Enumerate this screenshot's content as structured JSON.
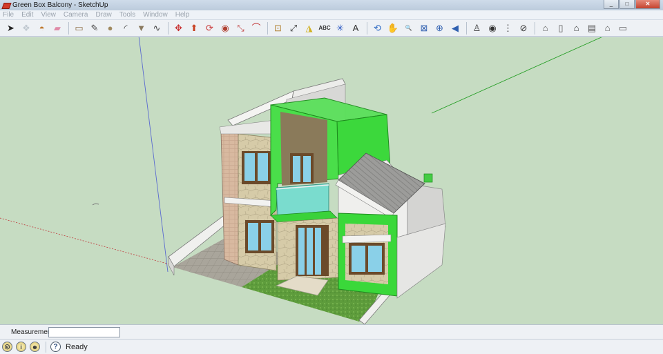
{
  "window": {
    "title": "Green Box Balcony - SketchUp",
    "controls": {
      "minimize": "_",
      "maximize": "□",
      "close": "✕"
    }
  },
  "menu": [
    "File",
    "Edit",
    "View",
    "Camera",
    "Draw",
    "Tools",
    "Window",
    "Help"
  ],
  "toolbar": [
    {
      "name": "select-tool",
      "icon": "arrow-cursor-icon",
      "glyph": "➤",
      "color": "#222222"
    },
    {
      "name": "make-component-tool",
      "icon": "component-icon",
      "glyph": "❖",
      "color": "#c0c8d0"
    },
    {
      "name": "paint-bucket-tool",
      "icon": "paint-bucket-icon",
      "glyph": "◓",
      "color": "#c07a30"
    },
    {
      "name": "eraser-tool",
      "icon": "eraser-icon",
      "glyph": "▰",
      "color": "#e08aa8"
    },
    {
      "sep": true
    },
    {
      "name": "rectangle-tool",
      "icon": "rectangle-icon",
      "glyph": "▭",
      "color": "#8a6a40"
    },
    {
      "name": "line-tool",
      "icon": "pencil-icon",
      "glyph": "✎",
      "color": "#4a4a4a"
    },
    {
      "name": "circle-tool",
      "icon": "circle-icon",
      "glyph": "●",
      "color": "#a08a60"
    },
    {
      "name": "arc-tool",
      "icon": "arc-icon",
      "glyph": "◜",
      "color": "#444444"
    },
    {
      "name": "polygon-tool",
      "icon": "polygon-icon",
      "glyph": "▼",
      "color": "#8a7a60"
    },
    {
      "name": "freehand-tool",
      "icon": "freehand-icon",
      "glyph": "∿",
      "color": "#444444"
    },
    {
      "sep": true
    },
    {
      "name": "move-tool",
      "icon": "move-icon",
      "glyph": "✥",
      "color": "#c83030"
    },
    {
      "name": "push-pull-tool",
      "icon": "push-pull-icon",
      "glyph": "⬆",
      "color": "#c84020"
    },
    {
      "name": "rotate-tool",
      "icon": "rotate-icon",
      "glyph": "⟳",
      "color": "#c83030"
    },
    {
      "name": "follow-me-tool",
      "icon": "follow-me-icon",
      "glyph": "◉",
      "color": "#b04030"
    },
    {
      "name": "scale-tool",
      "icon": "scale-icon",
      "glyph": "⤡",
      "color": "#c04040"
    },
    {
      "name": "offset-tool",
      "icon": "offset-icon",
      "glyph": "⌒",
      "color": "#c03030"
    },
    {
      "sep": true
    },
    {
      "name": "tape-measure-tool",
      "icon": "tape-measure-icon",
      "glyph": "⊡",
      "color": "#b08030"
    },
    {
      "name": "dimension-tool",
      "icon": "dimension-icon",
      "glyph": "⤢",
      "color": "#333333"
    },
    {
      "name": "protractor-tool",
      "icon": "protractor-icon",
      "glyph": "◮",
      "color": "#d0b020"
    },
    {
      "name": "text-tool",
      "icon": "text-icon",
      "glyph": "ABC",
      "color": "#333333"
    },
    {
      "name": "axes-tool",
      "icon": "axes-icon",
      "glyph": "✳",
      "color": "#2050c0"
    },
    {
      "name": "3d-text-tool",
      "icon": "3d-text-icon",
      "glyph": "A",
      "color": "#333333"
    },
    {
      "sep": true
    },
    {
      "name": "orbit-tool",
      "icon": "orbit-icon",
      "glyph": "⟲",
      "color": "#2060c0"
    },
    {
      "name": "pan-tool",
      "icon": "hand-icon",
      "glyph": "✋",
      "color": "#666666"
    },
    {
      "name": "zoom-tool",
      "icon": "magnifier-icon",
      "glyph": "🔍",
      "color": "#3060b0"
    },
    {
      "name": "zoom-window-tool",
      "icon": "zoom-window-icon",
      "glyph": "⊠",
      "color": "#3060b0"
    },
    {
      "name": "zoom-extents-tool",
      "icon": "zoom-extents-icon",
      "glyph": "⊕",
      "color": "#3060b0"
    },
    {
      "name": "previous-view-tool",
      "icon": "previous-view-icon",
      "glyph": "◀",
      "color": "#3060b0"
    },
    {
      "sep": true
    },
    {
      "name": "position-camera-tool",
      "icon": "position-camera-icon",
      "glyph": "♙",
      "color": "#333333"
    },
    {
      "name": "look-around-tool",
      "icon": "eye-icon",
      "glyph": "◉",
      "color": "#333333"
    },
    {
      "name": "walk-tool",
      "icon": "footprints-icon",
      "glyph": "⋮",
      "color": "#222222"
    },
    {
      "name": "section-plane-tool",
      "icon": "section-plane-icon",
      "glyph": "⊘",
      "color": "#333333"
    },
    {
      "sep": true
    },
    {
      "name": "iso-view",
      "icon": "iso-house-icon",
      "glyph": "⌂",
      "color": "#555555"
    },
    {
      "name": "top-view",
      "icon": "top-house-icon",
      "glyph": "▯",
      "color": "#555555"
    },
    {
      "name": "front-view",
      "icon": "front-house-icon",
      "glyph": "⌂",
      "color": "#333333"
    },
    {
      "name": "right-view",
      "icon": "right-house-icon",
      "glyph": "▤",
      "color": "#555555"
    },
    {
      "name": "back-view",
      "icon": "back-house-icon",
      "glyph": "⌂",
      "color": "#555555"
    },
    {
      "name": "left-view",
      "icon": "left-house-icon",
      "glyph": "▭",
      "color": "#555555"
    }
  ],
  "viewport": {
    "background": "#c6dcc2",
    "colors": {
      "balcony_green": "#3cdc3c",
      "wall_tan": "#d8b8a0",
      "stone": "#d4c8a8",
      "roof_gray": "#9a9a98",
      "lawn": "#5aa03a",
      "paving": "#a8a49a"
    }
  },
  "measurements": {
    "label": "Measurements",
    "value": ""
  },
  "status": {
    "text": "Ready",
    "icons": [
      "geo-location-icon",
      "credits-icon",
      "user-icon"
    ]
  }
}
